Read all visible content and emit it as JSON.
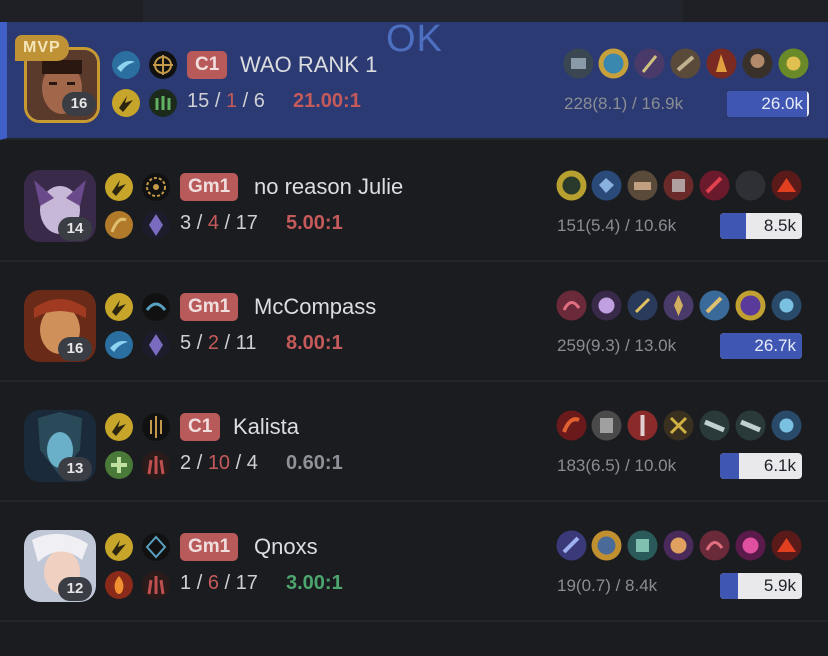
{
  "overlay": {
    "ok_label": "OK"
  },
  "colors": {
    "highlight": "#2b3a73",
    "death": "#c45a5a",
    "ratio_red": "#c45a5a",
    "ratio_gray": "#8e9197",
    "ratio_green": "#4da56e",
    "damage_fill": "#3f57b3"
  },
  "mvp_label": "MVP",
  "players": [
    {
      "level": "16",
      "rank": "C1",
      "name": "WAO RANK 1",
      "kills": "15",
      "deaths": "1",
      "assists": "6",
      "ratio": "21.00:1",
      "cs": "228(8.1) / 16.9k",
      "damage": "26.0k",
      "damage_frac": 0.97,
      "mvp": true
    },
    {
      "level": "14",
      "rank": "Gm1",
      "name": "no reason Julie",
      "kills": "3",
      "deaths": "4",
      "assists": "17",
      "ratio": "5.00:1",
      "cs": "151(5.4) / 10.6k",
      "damage": "8.5k",
      "damage_frac": 0.32
    },
    {
      "level": "16",
      "rank": "Gm1",
      "name": "McCompass",
      "kills": "5",
      "deaths": "2",
      "assists": "11",
      "ratio": "8.00:1",
      "cs": "259(9.3) / 13.0k",
      "damage": "26.7k",
      "damage_frac": 1.0
    },
    {
      "level": "13",
      "rank": "C1",
      "name": "Kalista",
      "kills": "2",
      "deaths": "10",
      "assists": "4",
      "ratio": "0.60:1",
      "cs": "183(6.5) / 10.0k",
      "damage": "6.1k",
      "damage_frac": 0.23
    },
    {
      "level": "12",
      "rank": "Gm1",
      "name": "Qnoxs",
      "kills": "1",
      "deaths": "6",
      "assists": "17",
      "ratio": "3.00:1",
      "cs": "19(0.7) / 8.4k",
      "damage": "5.9k",
      "damage_frac": 0.22
    }
  ],
  "separator": "/"
}
